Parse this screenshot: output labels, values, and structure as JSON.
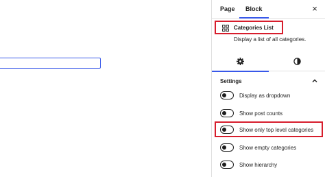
{
  "sidebar": {
    "tabs": [
      {
        "label": "Page"
      },
      {
        "label": "Block"
      }
    ],
    "close_symbol": "×",
    "block_card": {
      "icon": "grid-icon",
      "title": "Categories List",
      "description": "Display a list of all categories."
    },
    "subtabs": [
      {
        "icon": "gear-icon"
      },
      {
        "icon": "contrast-icon"
      }
    ],
    "panel": {
      "title": "Settings",
      "toggles": [
        {
          "label": "Display as dropdown",
          "checked": false
        },
        {
          "label": "Show post counts",
          "checked": false
        },
        {
          "label": "Show only top level categories",
          "checked": false
        },
        {
          "label": "Show empty categories",
          "checked": false
        },
        {
          "label": "Show hierarchy",
          "checked": false
        }
      ]
    }
  },
  "colors": {
    "accent": "#3858e9",
    "highlight": "#d71d2c",
    "text": "#1e1e1e",
    "border": "#e0e0e0"
  }
}
